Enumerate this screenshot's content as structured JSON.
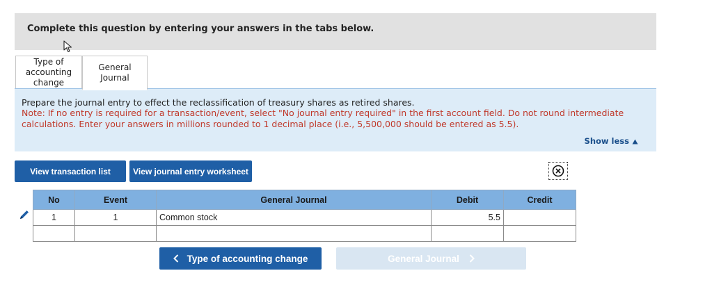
{
  "header": {
    "instruction": "Complete this question by entering your answers in the tabs below."
  },
  "tabs": [
    {
      "label": "Type of accounting change",
      "active": false
    },
    {
      "label": "General Journal",
      "active": true
    }
  ],
  "panel": {
    "prompt": "Prepare the journal entry to effect the reclassification of treasury shares as retired shares.",
    "note": "Note: If no entry is required for a transaction/event, select \"No journal entry required\" in the first account field. Do not round intermediate calculations. Enter your answers in millions rounded to 1 decimal place (i.e., 5,500,000 should be entered as 5.5).",
    "show_less": "Show less"
  },
  "buttons": {
    "view_transaction_list": "View transaction list",
    "view_journal_entry_worksheet": "View journal entry worksheet",
    "prev": "Type of accounting change",
    "next": "General Journal"
  },
  "table": {
    "headers": {
      "no": "No",
      "event": "Event",
      "general_journal": "General Journal",
      "debit": "Debit",
      "credit": "Credit"
    },
    "rows": [
      {
        "no": "1",
        "event": "1",
        "account": "Common stock",
        "debit": "5.5",
        "credit": ""
      },
      {
        "no": "",
        "event": "",
        "account": "",
        "debit": "",
        "credit": ""
      }
    ]
  },
  "icons": {
    "cursor": "cursor-icon",
    "close": "close-icon",
    "edit": "pencil-icon"
  },
  "colors": {
    "primary_button": "#1f5fa6",
    "disabled_button": "#d9e6f2",
    "note_text": "#c0392b",
    "table_header": "#7fb0e0",
    "panel_bg": "#ddecf8"
  }
}
